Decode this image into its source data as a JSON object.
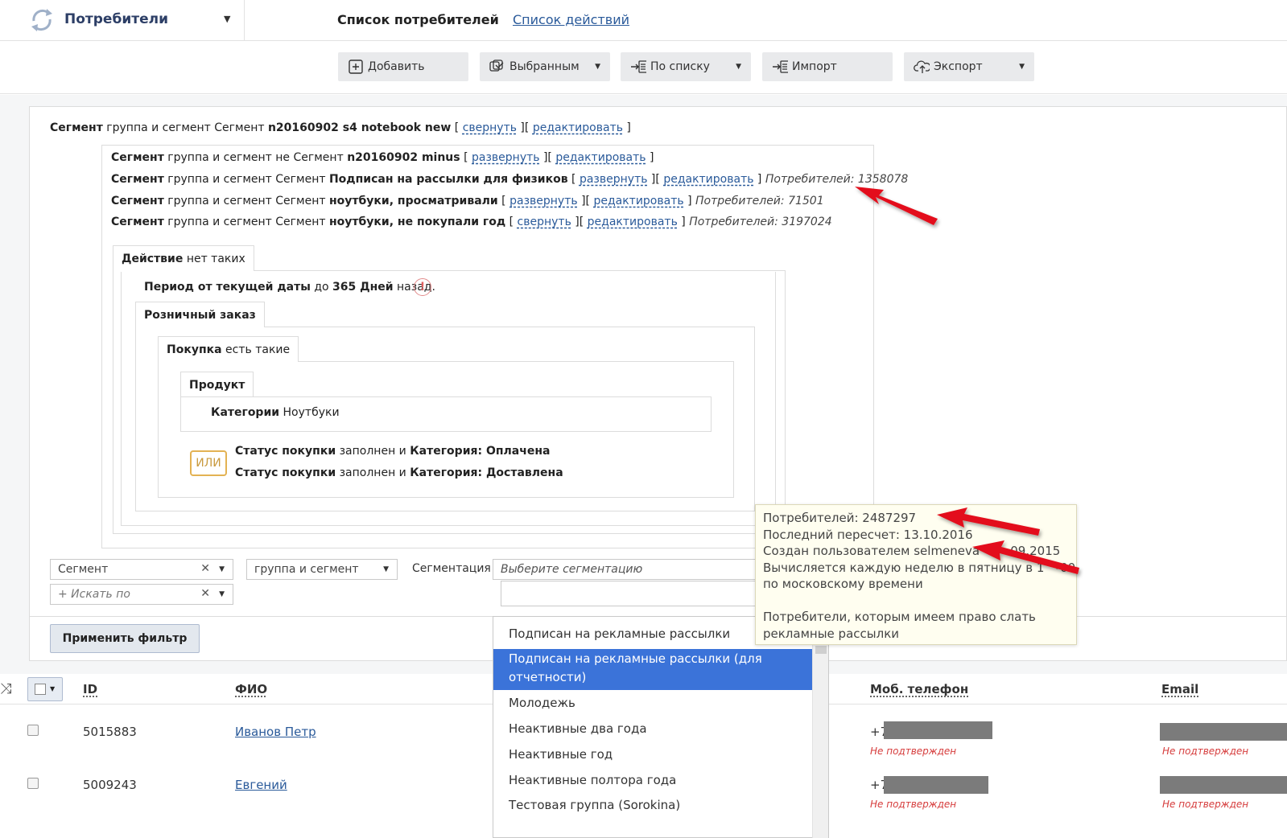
{
  "header": {
    "app_title": "Потребители",
    "tabs": [
      {
        "label": "Список потребителей",
        "active": true
      },
      {
        "label": "Список действий",
        "active": false
      }
    ]
  },
  "toolbar": {
    "add": "Добавить",
    "selected": "Выбранным",
    "by_list": "По списку",
    "import": "Импорт",
    "export": "Экспорт"
  },
  "filter": {
    "root": {
      "kw": "Сегмент",
      "text": "группа и сегмент Сегмент",
      "name": "n20160902 s4 notebook new",
      "collapse": "свернуть",
      "edit": "редактировать"
    },
    "conditions": [
      {
        "kw": "Сегмент",
        "text": "группа и сегмент не Сегмент",
        "name": "n20160902 minus",
        "toggle": "развернуть",
        "edit": "редактировать",
        "count": ""
      },
      {
        "kw": "Сегмент",
        "text": "группа и сегмент Сегмент",
        "name": "Подписан на рассылки для физиков",
        "toggle": "развернуть",
        "edit": "редактировать",
        "count": "Потребителей: 1358078"
      },
      {
        "kw": "Сегмент",
        "text": "группа и сегмент Сегмент",
        "name": "ноутбуки, просматривали",
        "toggle": "развернуть",
        "edit": "редактировать",
        "count": "Потребителей: 71501"
      },
      {
        "kw": "Сегмент",
        "text": "группа и сегмент Сегмент",
        "name": "ноутбуки, не покупали год",
        "toggle": "свернуть",
        "edit": "редактировать",
        "count": "Потребителей: 3197024"
      }
    ],
    "action": {
      "kw": "Действие",
      "text": "нет таких"
    },
    "period": {
      "kw1": "Период от текущей даты",
      "mid": "до",
      "kw2": "365 Дней",
      "end": "назад."
    },
    "retail_order": "Розничный заказ",
    "purchase": {
      "kw": "Покупка",
      "text": "есть такие"
    },
    "product": "Продукт",
    "category": {
      "kw": "Категории",
      "text": "Ноутбуки"
    },
    "or_label": "ИЛИ",
    "status_rows": [
      {
        "kw": "Статус покупки",
        "mid": "заполнен и",
        "kw2": "Категория: Оплачена"
      },
      {
        "kw": "Статус покупки",
        "mid": "заполнен и",
        "kw2": "Категория: Доставлена"
      }
    ]
  },
  "controls": {
    "type_select": "Сегмент",
    "search_by": "+ Искать по",
    "group_select": "группа и сегмент",
    "segmentation_label": "Сегментация",
    "segmentation_placeholder": "Выберите сегментацию",
    "apply": "Применить фильтр"
  },
  "dropdown": {
    "items": [
      {
        "label": "Подписан на рекламные рассылки",
        "selected": false
      },
      {
        "label": "Подписан на рекламные рассылки (для",
        "label2": "отчетности)",
        "selected": true
      },
      {
        "label": "Молодежь",
        "selected": false
      },
      {
        "label": "Неактивные два года",
        "selected": false
      },
      {
        "label": "Неактивные год",
        "selected": false
      },
      {
        "label": "Неактивные полтора года",
        "selected": false
      },
      {
        "label": "Тестовая группа (Sorokina)",
        "selected": false
      }
    ]
  },
  "tooltip": {
    "lines": [
      "Потребителей: 2487297",
      "Последний пересчет: 13.10.2016",
      "Создан пользователем selmeneva",
      "Вычисляется каждую неделю в пятницу в 1",
      "по московскому времени",
      "",
      "Потребители, которым имеем право слать",
      "рекламные рассылки"
    ],
    "date_fragment": "09.2015",
    "time_fragment": "-00"
  },
  "table": {
    "columns": [
      "ID",
      "ФИО",
      "Моб. телефон",
      "Email"
    ],
    "rows": [
      {
        "id": "5015883",
        "name": "Иванов Петр",
        "phone": "+7",
        "phone_status": "Не подтвержден",
        "email_status": "Не подтвержден"
      },
      {
        "id": "5009243",
        "name": "Евгений",
        "phone": "+7",
        "phone_status": "Не подтвержден",
        "email_status": "Не подтвержден"
      }
    ]
  },
  "colors": {
    "link": "#2a5a9a",
    "selected_item": "#3b73d9",
    "annotation_arrow": "#e3111a",
    "warning": "#d63c3c",
    "tooltip_bg": "#fffef0"
  }
}
